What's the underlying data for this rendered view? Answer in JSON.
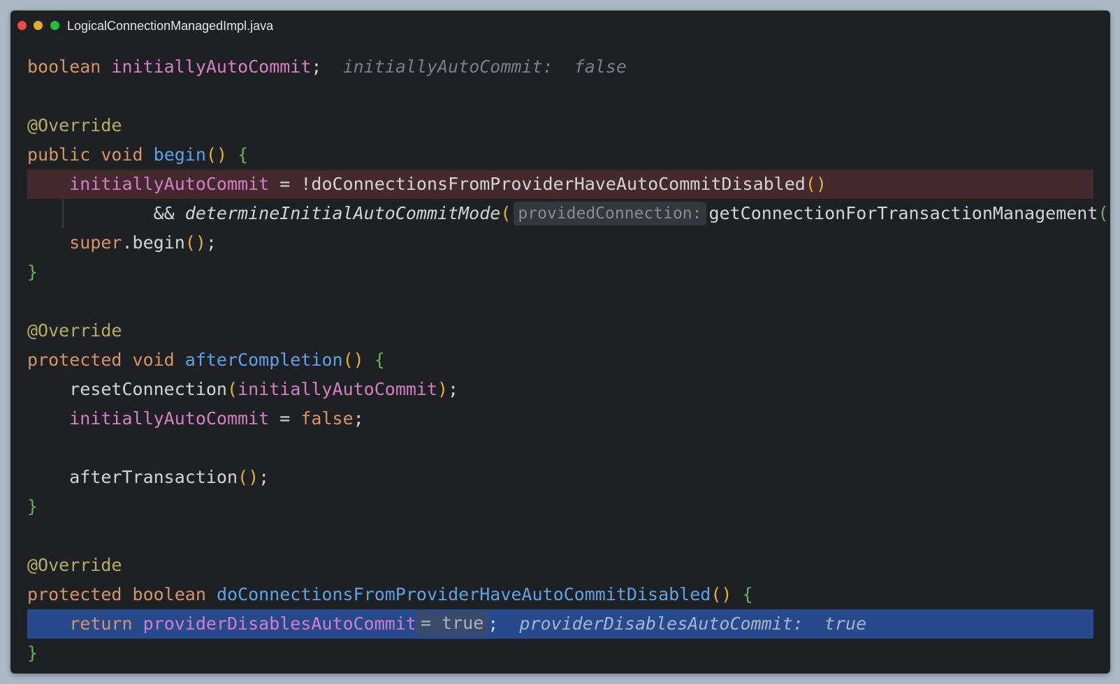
{
  "window": {
    "title": "LogicalConnectionManagedImpl.java"
  },
  "code": {
    "l1": {
      "kw": "boolean",
      "field": "initiallyAutoCommit",
      "end": ";",
      "hint": "initiallyAutoCommit:  false"
    },
    "l3": {
      "annotation": "@Override"
    },
    "l4": {
      "kw": "public void",
      "fn": "begin",
      "parens": "()",
      "brace": "{"
    },
    "l5": {
      "field": "initiallyAutoCommit",
      "op": " = !",
      "call": "doConnectionsFromProviderHaveAutoCommitDisabled",
      "parens": "()"
    },
    "l6": {
      "op": "&& ",
      "call": "determineInitialAutoCommitMode",
      "open": "(",
      "param_hint": "providedConnection:",
      "arg": "getConnectionForTransactionManagement",
      "inner_parens": "()",
      "close": ")",
      "end": ";"
    },
    "l7": {
      "kw": "super",
      "call": ".begin",
      "parens": "()",
      "end": ";"
    },
    "l8": {
      "brace": "}"
    },
    "l10": {
      "annotation": "@Override"
    },
    "l11": {
      "kw": "protected void",
      "fn": "afterCompletion",
      "parens": "()",
      "brace": "{"
    },
    "l12": {
      "call": "resetConnection",
      "open": "(",
      "field": "initiallyAutoCommit",
      "close": ")",
      "end": ";"
    },
    "l13": {
      "field": "initiallyAutoCommit",
      "op": " = ",
      "kw": "false",
      "end": ";"
    },
    "l15": {
      "call": "afterTransaction",
      "parens": "()",
      "end": ";"
    },
    "l16": {
      "brace": "}"
    },
    "l18": {
      "annotation": "@Override"
    },
    "l19": {
      "kw": "protected boolean",
      "fn": "doConnectionsFromProviderHaveAutoCommitDisabled",
      "parens": "()",
      "brace": "{"
    },
    "l20": {
      "kw": "return",
      "field": "providerDisablesAutoCommit",
      "inline_value": "= true",
      "end": ";",
      "hint": "providerDisablesAutoCommit:  true"
    },
    "l21": {
      "brace": "}"
    }
  },
  "colors": {
    "background": "#acbac8",
    "editor": "#1f2024",
    "breakpoint_line": "#442a2f",
    "execution_line": "#274a8f",
    "keyword": "#d79463",
    "field": "#d47fc4",
    "function": "#5ba3e8",
    "annotation": "#b3ae60"
  }
}
